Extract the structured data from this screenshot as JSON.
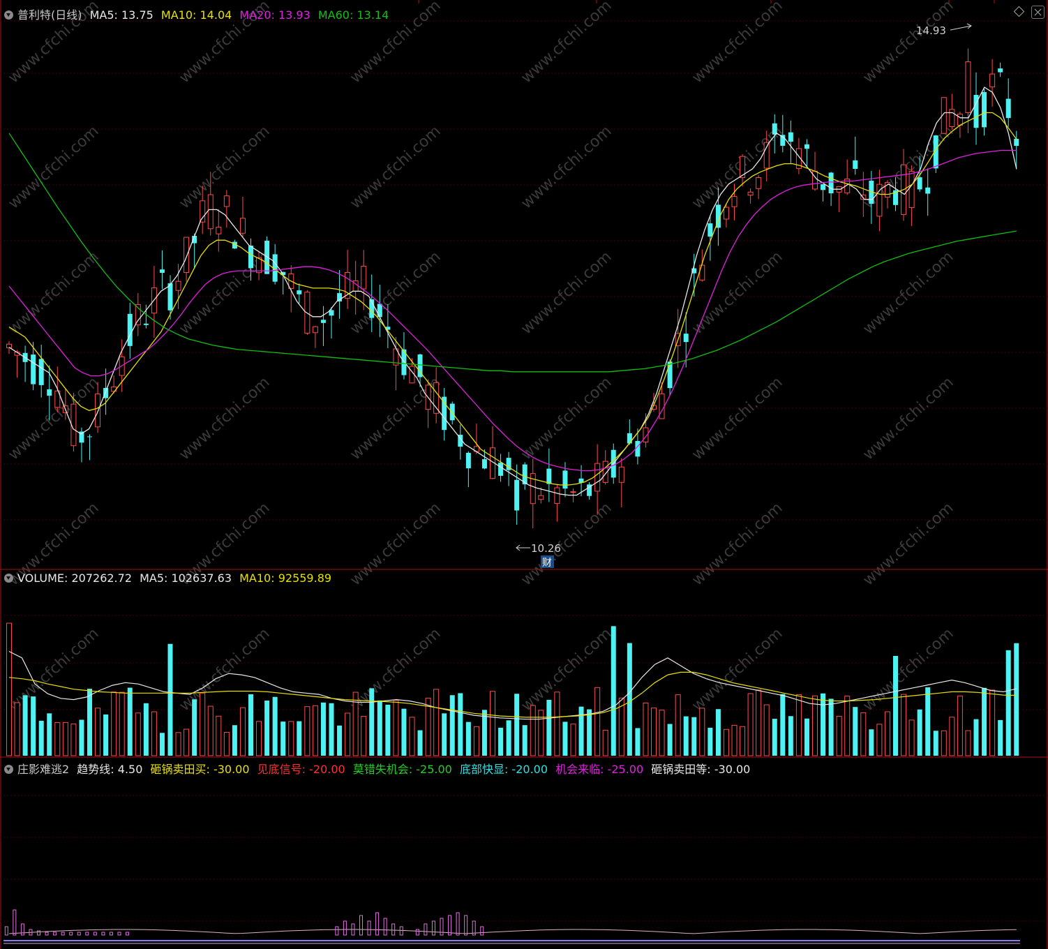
{
  "price_header": {
    "title": "普利特(日线)",
    "ma5": "MA5: 13.75",
    "ma10": "MA10: 14.04",
    "ma20": "MA20: 13.93",
    "ma60": "MA60: 13.14"
  },
  "volume_header": {
    "title": "VOLUME: 207262.72",
    "ma5": "MA5: 102637.63",
    "ma10": "MA10: 92559.89"
  },
  "indicator_header": {
    "title": "庄影难逃2",
    "trend": "趋势线: 4.50",
    "l1": "砸锅卖田买: -30.00",
    "l2": "见底信号: -20.00",
    "l3": "莫错失机会: -25.00",
    "l4": "底部快显: -20.00",
    "l5": "机会来临: -25.00",
    "l6": "砸锅卖田等: -30.00"
  },
  "colors": {
    "up": "#ff4a4a",
    "down": "#4ef2f2",
    "ma5": "#e8e8e8",
    "ma10": "#e8e000",
    "ma20": "#e020e0",
    "ma60": "#10c010",
    "panel_border": "#b01010",
    "grid": "#4a0000",
    "watermark": "#3a3a3a"
  },
  "watermark_text": "www.cfchi.com",
  "chart_data": [
    {
      "type": "candlestick",
      "title": "普利特(日线)",
      "ylim": [
        10.0,
        15.2
      ],
      "high_annotation": {
        "value": 14.93,
        "label": "14.93"
      },
      "low_annotation": {
        "value": 10.26,
        "label": "10.26",
        "marker": "财"
      },
      "series": [
        {
          "name": "MA5",
          "color": "#e8e8e8",
          "values": [
            12.0,
            11.95,
            11.9,
            11.85,
            11.8,
            11.75,
            11.6,
            11.4,
            11.2,
            11.15,
            11.2,
            11.35,
            11.55,
            11.75,
            11.95,
            12.1,
            12.25,
            12.35,
            12.45,
            12.55,
            12.6,
            12.7,
            12.85,
            13.05,
            13.25,
            13.35,
            13.35,
            13.3,
            13.2,
            13.1,
            13.0,
            12.95,
            12.9,
            12.85,
            12.75,
            12.6,
            12.45,
            12.35,
            12.3,
            12.3,
            12.35,
            12.45,
            12.5,
            12.55,
            12.55,
            12.5,
            12.35,
            12.2,
            12.05,
            11.9,
            11.8,
            11.7,
            11.55,
            11.45,
            11.35,
            11.25,
            11.15,
            11.05,
            11.0,
            10.95,
            10.9,
            10.85,
            10.8,
            10.75,
            10.7,
            10.65,
            10.62,
            10.6,
            10.58,
            10.56,
            10.55,
            10.55,
            10.6,
            10.65,
            10.7,
            10.8,
            10.9,
            11.0,
            11.1,
            11.2,
            11.35,
            11.55,
            11.8,
            12.05,
            12.3,
            12.6,
            12.9,
            13.15,
            13.35,
            13.5,
            13.6,
            13.65,
            13.7,
            13.75,
            13.85,
            14.0,
            14.1,
            14.05,
            13.95,
            13.85,
            13.75,
            13.65,
            13.6,
            13.55,
            13.55,
            13.6,
            13.55,
            13.45,
            13.45,
            13.55,
            13.6,
            13.55,
            13.5,
            13.6,
            13.75,
            14.0,
            14.2,
            14.3,
            14.3,
            14.25,
            14.25,
            14.4,
            14.55,
            14.5,
            14.35,
            14.1,
            13.75
          ]
        },
        {
          "name": "MA10",
          "color": "#e8e000",
          "values": [
            12.2,
            12.15,
            12.1,
            12.0,
            11.9,
            11.8,
            11.7,
            11.6,
            11.5,
            11.42,
            11.38,
            11.4,
            11.45,
            11.55,
            11.65,
            11.75,
            11.85,
            11.95,
            12.05,
            12.15,
            12.3,
            12.45,
            12.6,
            12.75,
            12.9,
            13.0,
            13.05,
            13.05,
            13.02,
            12.98,
            12.92,
            12.88,
            12.84,
            12.78,
            12.72,
            12.66,
            12.62,
            12.6,
            12.58,
            12.58,
            12.58,
            12.57,
            12.55,
            12.5,
            12.45,
            12.38,
            12.3,
            12.2,
            12.1,
            12.0,
            11.9,
            11.8,
            11.7,
            11.6,
            11.5,
            11.4,
            11.3,
            11.2,
            11.1,
            11.0,
            10.95,
            10.9,
            10.85,
            10.8,
            10.75,
            10.72,
            10.7,
            10.68,
            10.66,
            10.65,
            10.65,
            10.66,
            10.68,
            10.72,
            10.78,
            10.85,
            10.92,
            11.0,
            11.1,
            11.2,
            11.32,
            11.5,
            11.7,
            11.92,
            12.15,
            12.4,
            12.65,
            12.9,
            13.1,
            13.3,
            13.45,
            13.55,
            13.62,
            13.68,
            13.72,
            13.75,
            13.78,
            13.8,
            13.8,
            13.78,
            13.75,
            13.72,
            13.68,
            13.65,
            13.62,
            13.6,
            13.58,
            13.55,
            13.52,
            13.5,
            13.5,
            13.52,
            13.55,
            13.6,
            13.7,
            13.82,
            13.95,
            14.05,
            14.12,
            14.18,
            14.22,
            14.26,
            14.3,
            14.3,
            14.25,
            14.15,
            14.04
          ]
        },
        {
          "name": "MA20",
          "color": "#e020e0",
          "values": [
            12.6,
            12.5,
            12.4,
            12.3,
            12.2,
            12.1,
            12.0,
            11.9,
            11.8,
            11.75,
            11.72,
            11.72,
            11.74,
            11.78,
            11.83,
            11.88,
            11.93,
            11.98,
            12.05,
            12.13,
            12.22,
            12.32,
            12.43,
            12.53,
            12.62,
            12.68,
            12.72,
            12.74,
            12.75,
            12.75,
            12.75,
            12.75,
            12.75,
            12.76,
            12.77,
            12.78,
            12.79,
            12.79,
            12.78,
            12.76,
            12.73,
            12.69,
            12.64,
            12.58,
            12.52,
            12.45,
            12.38,
            12.3,
            12.22,
            12.14,
            12.06,
            11.98,
            11.89,
            11.8,
            11.71,
            11.62,
            11.53,
            11.44,
            11.35,
            11.26,
            11.18,
            11.1,
            11.03,
            10.97,
            10.92,
            10.88,
            10.85,
            10.83,
            10.81,
            10.8,
            10.79,
            10.79,
            10.8,
            10.82,
            10.85,
            10.9,
            10.96,
            11.05,
            11.15,
            11.28,
            11.42,
            11.58,
            11.76,
            11.95,
            12.15,
            12.35,
            12.55,
            12.75,
            12.93,
            13.08,
            13.2,
            13.3,
            13.38,
            13.45,
            13.5,
            13.54,
            13.57,
            13.59,
            13.6,
            13.61,
            13.62,
            13.62,
            13.63,
            13.63,
            13.64,
            13.65,
            13.66,
            13.67,
            13.68,
            13.69,
            13.7,
            13.72,
            13.74,
            13.77,
            13.8,
            13.83,
            13.86,
            13.88,
            13.9,
            13.91,
            13.92,
            13.93,
            13.93,
            13.93
          ]
        },
        {
          "name": "MA60",
          "color": "#10c010",
          "values": [
            14.1,
            13.92,
            13.74,
            13.56,
            13.38,
            13.21,
            13.04,
            12.88,
            12.73,
            12.59,
            12.47,
            12.36,
            12.27,
            12.19,
            12.13,
            12.08,
            12.05,
            12.02,
            12.0,
            11.98,
            11.97,
            11.96,
            11.95,
            11.94,
            11.93,
            11.92,
            11.91,
            11.9,
            11.89,
            11.88,
            11.87,
            11.86,
            11.85,
            11.84,
            11.83,
            11.82,
            11.81,
            11.8,
            11.79,
            11.78,
            11.77,
            11.77,
            11.76,
            11.76,
            11.76,
            11.76,
            11.76,
            11.76,
            11.76,
            11.76,
            11.76,
            11.77,
            11.78,
            11.79,
            11.81,
            11.83,
            11.86,
            11.89,
            11.93,
            11.97,
            12.02,
            12.07,
            12.13,
            12.19,
            12.25,
            12.32,
            12.39,
            12.46,
            12.53,
            12.6,
            12.67,
            12.73,
            12.79,
            12.84,
            12.88,
            12.92,
            12.95,
            12.98,
            13.01,
            13.04,
            13.06,
            13.08,
            13.1,
            13.12,
            13.14
          ]
        }
      ]
    },
    {
      "type": "bar",
      "title": "VOLUME",
      "ylim": [
        0,
        260000
      ],
      "series": [
        {
          "name": "MA5",
          "values": [
            160000,
            150000,
            110000,
            95000,
            88000,
            86000,
            90000,
            100000,
            108000,
            112000,
            110000,
            104000,
            98000,
            96000,
            94000,
            104000,
            118000,
            126000,
            124000,
            120000,
            112000,
            104000,
            98000,
            96000,
            94000,
            88000,
            84000,
            82000,
            82000,
            84000,
            86000,
            84000,
            80000,
            74000,
            70000,
            66000,
            62000,
            60000,
            58000,
            57000,
            56000,
            56000,
            58000,
            60000,
            62000,
            64000,
            68000,
            78000,
            96000,
            120000,
            140000,
            150000,
            138000,
            126000,
            118000,
            112000,
            108000,
            104000,
            100000,
            96000,
            92000,
            86000,
            80000,
            78000,
            80000,
            84000,
            88000,
            92000,
            96000,
            100000,
            104000,
            108000,
            112000,
            116000,
            112000,
            106000,
            100000,
            98000,
            102637
          ]
        },
        {
          "name": "MA10",
          "values": [
            120000,
            118000,
            115000,
            110000,
            106000,
            102000,
            100000,
            98000,
            97000,
            96000,
            96000,
            96000,
            96000,
            96000,
            96000,
            97000,
            98000,
            99000,
            99000,
            99000,
            98000,
            96000,
            94000,
            92000,
            90000,
            88000,
            86000,
            85000,
            84000,
            83000,
            82000,
            80000,
            77000,
            74000,
            71000,
            68000,
            65000,
            63000,
            61000,
            60000,
            59000,
            59000,
            59000,
            60000,
            61000,
            63000,
            66000,
            72000,
            82000,
            96000,
            112000,
            124000,
            128000,
            128000,
            124000,
            118000,
            112000,
            108000,
            104000,
            100000,
            96000,
            92000,
            88000,
            85000,
            84000,
            84000,
            85000,
            86000,
            88000,
            90000,
            92000,
            94000,
            96000,
            98000,
            98000,
            97000,
            95000,
            93000,
            92560
          ]
        }
      ]
    },
    {
      "type": "bar",
      "title": "庄影难逃2",
      "series": [
        {
          "name": "趋势线",
          "values": [
            4.5
          ]
        },
        {
          "name": "砸锅卖田买",
          "values": [
            -30.0
          ]
        },
        {
          "name": "见底信号",
          "values": [
            -20.0
          ]
        },
        {
          "name": "莫错失机会",
          "values": [
            -25.0
          ]
        },
        {
          "name": "底部快显",
          "values": [
            -20.0
          ]
        },
        {
          "name": "机会来临",
          "values": [
            -25.0
          ]
        },
        {
          "name": "砸锅卖田等",
          "values": [
            -30.0
          ]
        }
      ]
    }
  ]
}
